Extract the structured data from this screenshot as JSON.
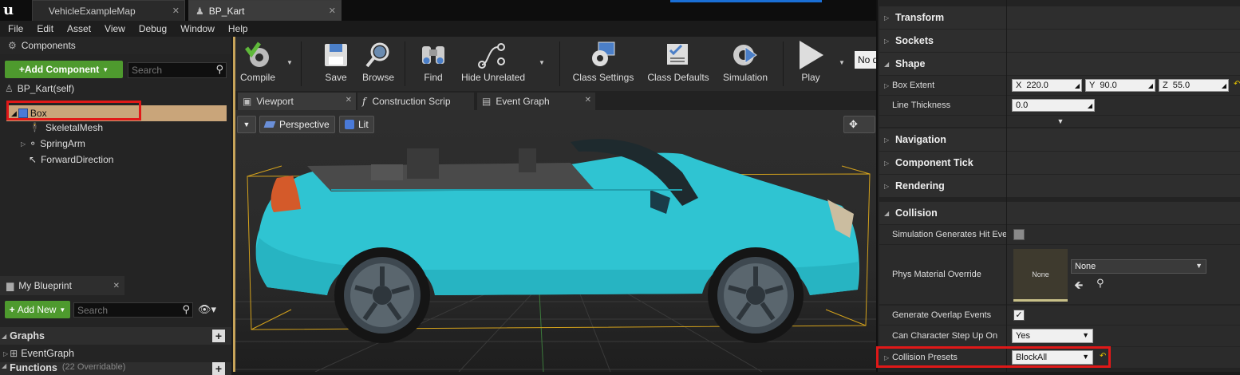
{
  "window": {
    "tabs": [
      {
        "label": "VehicleExampleMap"
      },
      {
        "label": "BP_Kart"
      }
    ]
  },
  "menu": [
    "File",
    "Edit",
    "Asset",
    "View",
    "Debug",
    "Window",
    "Help"
  ],
  "components": {
    "header": "Components",
    "add_button": "+Add Component",
    "search_placeholder": "Search",
    "self_label": "BP_Kart(self)",
    "tree": [
      {
        "label": "Box",
        "selected": true
      },
      {
        "label": "SkeletalMesh"
      },
      {
        "label": "SpringArm"
      },
      {
        "label": "ForwardDirection"
      }
    ]
  },
  "my_blueprint": {
    "header": "My Blueprint",
    "add_new": "Add New",
    "search_placeholder": "Search",
    "sections": [
      "Graphs",
      "Functions"
    ],
    "graph_items": [
      "EventGraph"
    ],
    "functions_note": "(22 Overridable)"
  },
  "toolbar": {
    "buttons": [
      "Compile",
      "Save",
      "Browse",
      "Find",
      "Hide Unrelated",
      "Class Settings",
      "Class Defaults",
      "Simulation",
      "Play"
    ],
    "debug_filter": "No d"
  },
  "editor_tabs": [
    "Viewport",
    "Construction Scrip",
    "Event Graph"
  ],
  "viewport": {
    "perspective": "Perspective",
    "lit": "Lit"
  },
  "details": {
    "categories": {
      "transform": "Transform",
      "sockets": "Sockets",
      "shape": "Shape",
      "navigation": "Navigation",
      "component_tick": "Component Tick",
      "rendering": "Rendering",
      "collision": "Collision"
    },
    "shape": {
      "box_extent_label": "Box Extent",
      "x": "220.0",
      "y": "90.0",
      "z": "55.0",
      "x_axis": "X",
      "y_axis": "Y",
      "z_axis": "Z",
      "line_thickness_label": "Line Thickness",
      "line_thickness": "0.0"
    },
    "collision": {
      "sim_hit_label": "Simulation Generates Hit Eve",
      "phys_material_label": "Phys Material Override",
      "phys_material_thumb": "None",
      "phys_material_value": "None",
      "overlap_label": "Generate Overlap Events",
      "step_up_label": "Can Character Step Up On",
      "step_up_value": "Yes",
      "presets_label": "Collision Presets",
      "presets_value": "BlockAll"
    }
  },
  "colors": {
    "accent_green": "#4e9a2e",
    "selection": "#c9a57a",
    "highlight_red": "#e01818",
    "car_body": "#2fc4d2"
  }
}
